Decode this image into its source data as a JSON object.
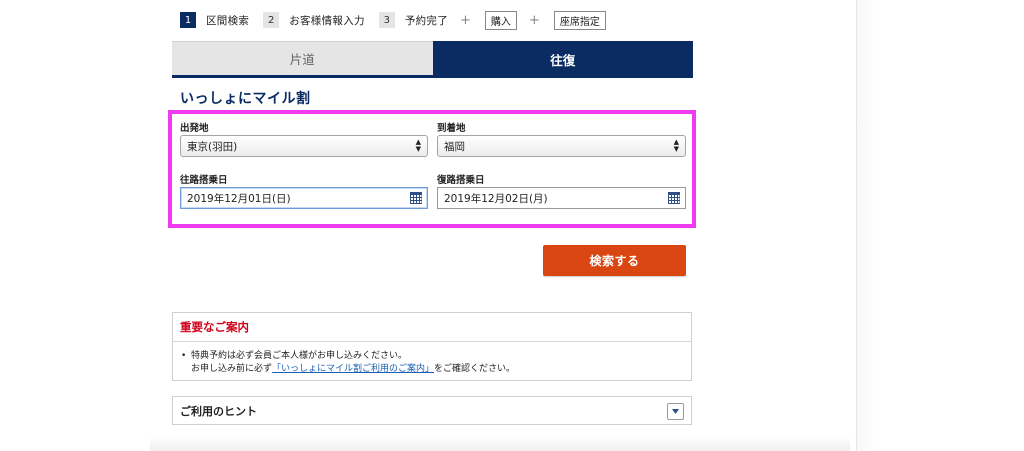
{
  "steps": [
    {
      "num": "1",
      "label": "区間検索"
    },
    {
      "num": "2",
      "label": "お客様情報入力"
    },
    {
      "num": "3",
      "label": "予約完了"
    }
  ],
  "step_plus": "+",
  "optional_steps": [
    "購入",
    "座席指定"
  ],
  "tabs": {
    "oneway": "片道",
    "roundtrip": "往復"
  },
  "section_title": "いっしょにマイル割",
  "form": {
    "departure_label": "出発地",
    "departure_value": "東京(羽田)",
    "arrival_label": "到着地",
    "arrival_value": "福岡",
    "outbound_label": "往路搭乗日",
    "outbound_value": "2019年12月01日(日)",
    "return_label": "復路搭乗日",
    "return_value": "2019年12月02日(月)"
  },
  "search_button": "検索する",
  "notice": {
    "title": "重要なご案内",
    "bullet": "•",
    "line1": "特典予約は必ず会員ご本人様がお申し込みください。",
    "line2_prefix": "お申し込み前に必ず",
    "line2_link": "「いっしょにマイル割ご利用のご案内」",
    "line2_suffix": "をご確認ください。"
  },
  "hint": {
    "title": "ご利用のヒント"
  },
  "colors": {
    "brand_navy": "#0b2c63",
    "accent_orange": "#d94612",
    "highlight_magenta": "#f03cf0",
    "notice_red": "#d0021b",
    "link_blue": "#1a5fb4"
  },
  "icons": [
    "calendar-icon",
    "select-arrows-icon",
    "chevron-down-icon"
  ]
}
